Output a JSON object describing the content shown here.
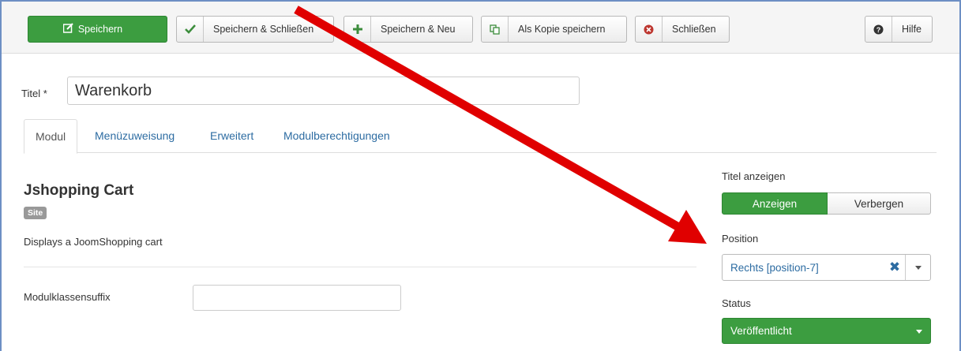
{
  "toolbar": {
    "save": "Speichern",
    "save_close": "Speichern & Schließen",
    "save_new": "Speichern & Neu",
    "save_copy": "Als Kopie speichern",
    "close": "Schließen",
    "help": "Hilfe"
  },
  "form": {
    "title_label": "Titel *",
    "title_value": "Warenkorb"
  },
  "tabs": [
    "Modul",
    "Menüzuweisung",
    "Erweitert",
    "Modulberechtigungen"
  ],
  "module": {
    "name": "Jshopping Cart",
    "badge": "Site",
    "description": "Displays a JoomShopping cart",
    "suffix_label": "Modulklassensuffix",
    "suffix_value": ""
  },
  "sidebar": {
    "show_title_label": "Titel anzeigen",
    "show_option": "Anzeigen",
    "hide_option": "Verbergen",
    "position_label": "Position",
    "position_value": "Rechts [position-7]",
    "status_label": "Status",
    "status_value": "Veröffentlicht"
  },
  "colors": {
    "green": "#3c9d40",
    "link_blue": "#2d6ca2",
    "arrow_red": "#e00000"
  }
}
